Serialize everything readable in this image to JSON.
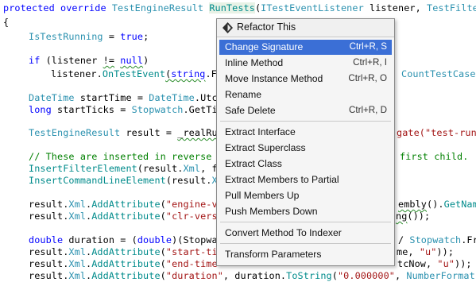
{
  "code": {
    "l1": {
      "a": "protected override ",
      "b": "TestEngineResult",
      "c": " ",
      "d": "RunTests",
      "e": "(",
      "f": "ITestEventListener",
      "g": " listener, ",
      "h": "TestFilter"
    },
    "l2": "{",
    "l3": {
      "a": "IsTestRunning",
      "b": " = ",
      "c": "true",
      "d": ";"
    },
    "l4": {
      "a": "if",
      "b": " (listener ",
      "c": "!=",
      "d": " ",
      "e": "null",
      "f": ")"
    },
    "l5": {
      "a": "listener.",
      "b": "OnTestEvent",
      "c": "(",
      "d": "string",
      "e": ".Fo"
    },
    "l5b": "CountTestCases",
    "l6": {
      "a": "DateTime",
      "b": " startTime = ",
      "c": "DateTime",
      "d": ".UtcN"
    },
    "l7": {
      "a": "long",
      "b": " startTicks = ",
      "c": "Stopwatch",
      "d": ".GetTim"
    },
    "l8": {
      "a": "TestEngineResult",
      "b": " result = ",
      "c": "_realRun"
    },
    "l8b": "gate(\"test-run\",",
    "l9a": "// These are inserted in reverse o",
    "l9b": "first child.",
    "l10": {
      "a": "InsertFilterElement",
      "b": "(result.",
      "c": "Xml",
      "d": ", fi"
    },
    "l11": {
      "a": "InsertCommandLineElement",
      "b": "(result.",
      "c": "Xm"
    },
    "l12": {
      "a": "result.",
      "b": "Xml",
      "c": ".",
      "d": "AddAttribute",
      "e": "(",
      "f": "\"engine-ve"
    },
    "l12b": {
      "a": "embly",
      "b": "().",
      "c": "GetName"
    },
    "l13": {
      "a": "result.",
      "b": "Xml",
      "c": ".",
      "d": "AddAttribute",
      "e": "(",
      "f": "\"clr-versi"
    },
    "l13b": {
      "a": "ng",
      "b": "());"
    },
    "l14": {
      "a": "double",
      "b": " duration = (",
      "c": "double",
      "d": ")(Stopwat"
    },
    "l14b": {
      "a": "/ ",
      "b": "Stopwatch",
      "c": ".Fre"
    },
    "l15": {
      "a": "result.",
      "b": "Xml",
      "c": ".",
      "d": "AddAttribute",
      "e": "(",
      "f": "\"start-tim"
    },
    "l15b": {
      "a": "me, ",
      "b": "\"u\"",
      "c": "));"
    },
    "l16": {
      "a": "result.",
      "b": "Xml",
      "c": ".",
      "d": "AddAttribute",
      "e": "(",
      "f": "\"end-time\""
    },
    "l16b": {
      "a": "tcNow, ",
      "b": "\"u\"",
      "c": "));"
    },
    "l17": {
      "a": "result.",
      "b": "Xml",
      "c": ".",
      "d": "AddAttribute",
      "e": "(",
      "f": "\"duration\"",
      "g": ", duration.",
      "h": "ToString",
      "i": "(",
      "j": "\"0.000000\"",
      "k": ", ",
      "l": "NumberFormatIns"
    }
  },
  "menu": {
    "title": "Refactor This",
    "items": [
      {
        "label": "Change Signature",
        "shortcut": "Ctrl+R, S"
      },
      {
        "label": "Inline Method",
        "shortcut": "Ctrl+R, I"
      },
      {
        "label": "Move Instance Method",
        "shortcut": "Ctrl+R, O"
      },
      {
        "label": "Rename",
        "shortcut": ""
      },
      {
        "label": "Safe Delete",
        "shortcut": "Ctrl+R, D"
      },
      {
        "label": "Extract Interface",
        "shortcut": ""
      },
      {
        "label": "Extract Superclass",
        "shortcut": ""
      },
      {
        "label": "Extract Class",
        "shortcut": ""
      },
      {
        "label": "Extract Members to Partial",
        "shortcut": ""
      },
      {
        "label": "Pull Members Up",
        "shortcut": ""
      },
      {
        "label": "Push Members Down",
        "shortcut": ""
      },
      {
        "label": "Convert Method To Indexer",
        "shortcut": ""
      },
      {
        "label": "Transform Parameters",
        "shortcut": ""
      }
    ],
    "selected_item": "Change Signature"
  },
  "colors": {
    "keyword": "#0000ff",
    "type": "#2b91af",
    "method": "#008b8b",
    "comment": "#008000",
    "string": "#a31515",
    "selection": "#3b6fd6"
  },
  "icons": {
    "menu_title_icon": "refactor-icon"
  }
}
